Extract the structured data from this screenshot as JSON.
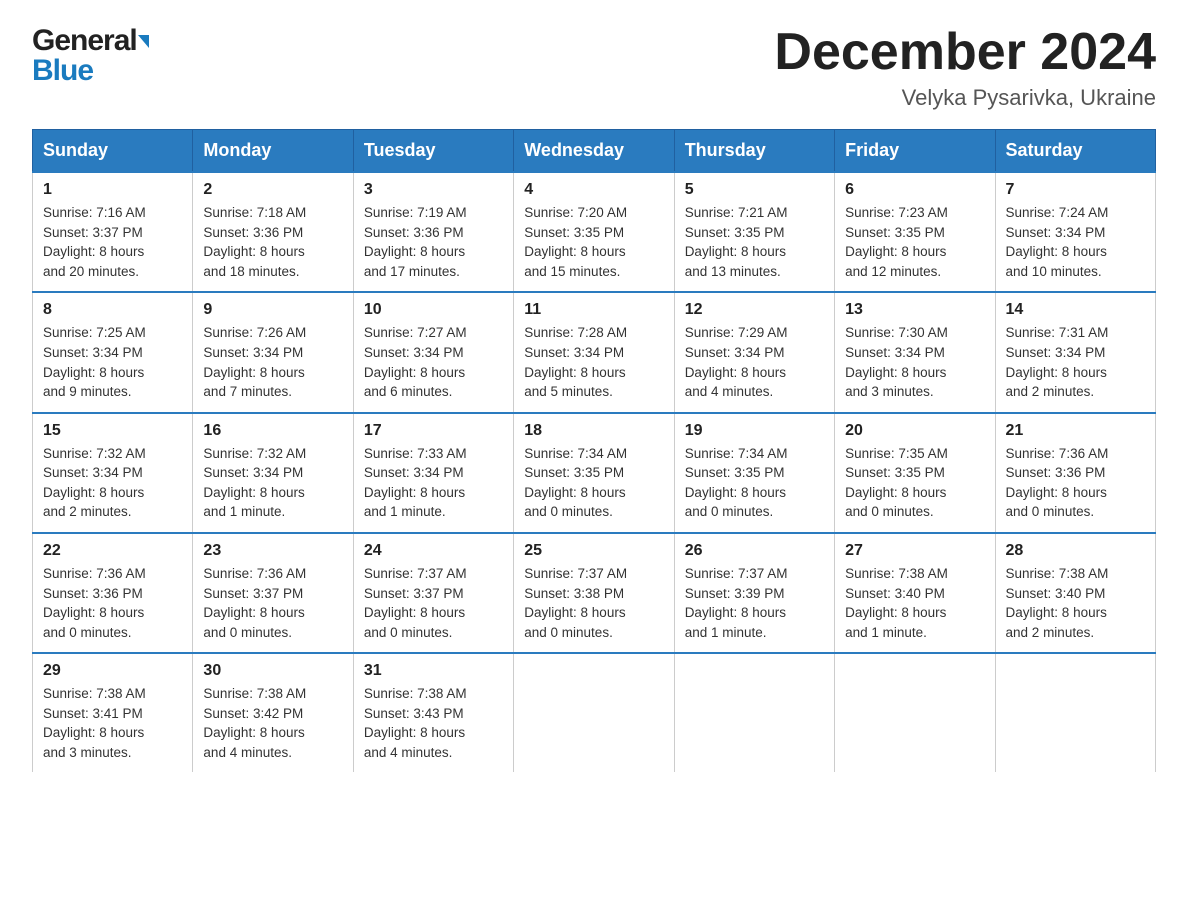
{
  "header": {
    "logo_line1": "General",
    "logo_line2": "Blue",
    "month_title": "December 2024",
    "location": "Velyka Pysarivka, Ukraine"
  },
  "weekdays": [
    "Sunday",
    "Monday",
    "Tuesday",
    "Wednesday",
    "Thursday",
    "Friday",
    "Saturday"
  ],
  "weeks": [
    [
      {
        "num": "1",
        "info": "Sunrise: 7:16 AM\nSunset: 3:37 PM\nDaylight: 8 hours\nand 20 minutes."
      },
      {
        "num": "2",
        "info": "Sunrise: 7:18 AM\nSunset: 3:36 PM\nDaylight: 8 hours\nand 18 minutes."
      },
      {
        "num": "3",
        "info": "Sunrise: 7:19 AM\nSunset: 3:36 PM\nDaylight: 8 hours\nand 17 minutes."
      },
      {
        "num": "4",
        "info": "Sunrise: 7:20 AM\nSunset: 3:35 PM\nDaylight: 8 hours\nand 15 minutes."
      },
      {
        "num": "5",
        "info": "Sunrise: 7:21 AM\nSunset: 3:35 PM\nDaylight: 8 hours\nand 13 minutes."
      },
      {
        "num": "6",
        "info": "Sunrise: 7:23 AM\nSunset: 3:35 PM\nDaylight: 8 hours\nand 12 minutes."
      },
      {
        "num": "7",
        "info": "Sunrise: 7:24 AM\nSunset: 3:34 PM\nDaylight: 8 hours\nand 10 minutes."
      }
    ],
    [
      {
        "num": "8",
        "info": "Sunrise: 7:25 AM\nSunset: 3:34 PM\nDaylight: 8 hours\nand 9 minutes."
      },
      {
        "num": "9",
        "info": "Sunrise: 7:26 AM\nSunset: 3:34 PM\nDaylight: 8 hours\nand 7 minutes."
      },
      {
        "num": "10",
        "info": "Sunrise: 7:27 AM\nSunset: 3:34 PM\nDaylight: 8 hours\nand 6 minutes."
      },
      {
        "num": "11",
        "info": "Sunrise: 7:28 AM\nSunset: 3:34 PM\nDaylight: 8 hours\nand 5 minutes."
      },
      {
        "num": "12",
        "info": "Sunrise: 7:29 AM\nSunset: 3:34 PM\nDaylight: 8 hours\nand 4 minutes."
      },
      {
        "num": "13",
        "info": "Sunrise: 7:30 AM\nSunset: 3:34 PM\nDaylight: 8 hours\nand 3 minutes."
      },
      {
        "num": "14",
        "info": "Sunrise: 7:31 AM\nSunset: 3:34 PM\nDaylight: 8 hours\nand 2 minutes."
      }
    ],
    [
      {
        "num": "15",
        "info": "Sunrise: 7:32 AM\nSunset: 3:34 PM\nDaylight: 8 hours\nand 2 minutes."
      },
      {
        "num": "16",
        "info": "Sunrise: 7:32 AM\nSunset: 3:34 PM\nDaylight: 8 hours\nand 1 minute."
      },
      {
        "num": "17",
        "info": "Sunrise: 7:33 AM\nSunset: 3:34 PM\nDaylight: 8 hours\nand 1 minute."
      },
      {
        "num": "18",
        "info": "Sunrise: 7:34 AM\nSunset: 3:35 PM\nDaylight: 8 hours\nand 0 minutes."
      },
      {
        "num": "19",
        "info": "Sunrise: 7:34 AM\nSunset: 3:35 PM\nDaylight: 8 hours\nand 0 minutes."
      },
      {
        "num": "20",
        "info": "Sunrise: 7:35 AM\nSunset: 3:35 PM\nDaylight: 8 hours\nand 0 minutes."
      },
      {
        "num": "21",
        "info": "Sunrise: 7:36 AM\nSunset: 3:36 PM\nDaylight: 8 hours\nand 0 minutes."
      }
    ],
    [
      {
        "num": "22",
        "info": "Sunrise: 7:36 AM\nSunset: 3:36 PM\nDaylight: 8 hours\nand 0 minutes."
      },
      {
        "num": "23",
        "info": "Sunrise: 7:36 AM\nSunset: 3:37 PM\nDaylight: 8 hours\nand 0 minutes."
      },
      {
        "num": "24",
        "info": "Sunrise: 7:37 AM\nSunset: 3:37 PM\nDaylight: 8 hours\nand 0 minutes."
      },
      {
        "num": "25",
        "info": "Sunrise: 7:37 AM\nSunset: 3:38 PM\nDaylight: 8 hours\nand 0 minutes."
      },
      {
        "num": "26",
        "info": "Sunrise: 7:37 AM\nSunset: 3:39 PM\nDaylight: 8 hours\nand 1 minute."
      },
      {
        "num": "27",
        "info": "Sunrise: 7:38 AM\nSunset: 3:40 PM\nDaylight: 8 hours\nand 1 minute."
      },
      {
        "num": "28",
        "info": "Sunrise: 7:38 AM\nSunset: 3:40 PM\nDaylight: 8 hours\nand 2 minutes."
      }
    ],
    [
      {
        "num": "29",
        "info": "Sunrise: 7:38 AM\nSunset: 3:41 PM\nDaylight: 8 hours\nand 3 minutes."
      },
      {
        "num": "30",
        "info": "Sunrise: 7:38 AM\nSunset: 3:42 PM\nDaylight: 8 hours\nand 4 minutes."
      },
      {
        "num": "31",
        "info": "Sunrise: 7:38 AM\nSunset: 3:43 PM\nDaylight: 8 hours\nand 4 minutes."
      },
      null,
      null,
      null,
      null
    ]
  ]
}
